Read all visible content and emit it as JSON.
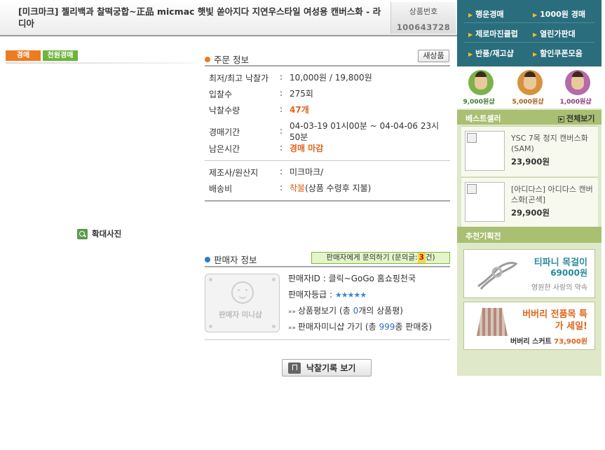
{
  "header": {
    "title": "[미크마크] 젤리백과 찰떡궁합~正品 micmac 햇빛 쏟아지다 지연우스타일 여성용 캔버스화 - 라디아",
    "item_no_label": "상품번호",
    "item_no": "100643728"
  },
  "left": {
    "badges": [
      "경매",
      "천원경매"
    ],
    "zoom_label": "확대사진"
  },
  "order": {
    "heading": "주문 정보",
    "new_button": "새상품",
    "rows": [
      {
        "label": "최저/최고 낙찰가",
        "value": "10,000원 / 19,800원"
      },
      {
        "label": "입찰수",
        "value": "275회"
      },
      {
        "label": "낙찰수량",
        "value": "47개"
      },
      {
        "label": "경매기간",
        "value": "04-03-19 01시00분 ~ 04-04-06 23시 50분"
      },
      {
        "label": "남은시간",
        "value": "경매 마감"
      }
    ],
    "rows2": [
      {
        "label": "제조사/원산지",
        "value": "미크마크/"
      },
      {
        "label": "배송비",
        "value_highlight": "착불",
        "value_rest": "(상품 수령후 지불)"
      }
    ],
    "colon": ":"
  },
  "seller": {
    "heading": "판매자 정보",
    "ask_prefix": "판매자에게 문의하기 (문의글:",
    "ask_count": "3",
    "ask_suffix": "건)",
    "mini_shop_label": "판매자 미니샵",
    "id_label": "판매자ID : ",
    "id_value": "클릭~GoGo 홈쇼핑천국",
    "grade_label": "판매자등급 : ",
    "grade_stars": "★★★★★",
    "review_prefix": "상품평보기 (총 ",
    "review_count": "0",
    "review_suffix": "개의 상품평)",
    "shop_prefix": "판매자미니샵 가기 (총 ",
    "shop_count": "999",
    "shop_suffix": "종 판매중)",
    "arrow_glyph": "»»",
    "bid_record_button": "낙찰기록 보기"
  },
  "sidebar": {
    "nav": [
      {
        "label": "행운경매"
      },
      {
        "label": "1000원 경매"
      },
      {
        "label": "제로마진클럽"
      },
      {
        "label": "열린가판대"
      },
      {
        "label": "반품/재고샵"
      },
      {
        "label": "할인쿠폰모음"
      }
    ],
    "nav_marker": "▶",
    "coins": [
      {
        "amount": "9,000원샵",
        "color": "#3f7d2e",
        "ring": "#7bb24a"
      },
      {
        "amount": "5,000원샵",
        "color": "#a5601c",
        "ring": "#d8913d"
      },
      {
        "amount": "1,000원샵",
        "color": "#8a3a7d",
        "ring": "#b56aa9"
      }
    ],
    "best_title": "베스트셀러",
    "best_more": "전체보기",
    "best_more_glyph": "▶",
    "best_items": [
      {
        "name": "YSC 7목 청지 캔버스화(SAM)",
        "price": "23,900원"
      },
      {
        "name": "[아디다스] 아디다스 캔버스화[곤색]",
        "price": "29,900원"
      }
    ],
    "rec_title": "추천기획전",
    "ads": [
      {
        "title": "티파니 목걸이",
        "price": "69000원",
        "sub": "영원한 사랑의 약속",
        "title_color": "#2a8a9a"
      },
      {
        "title": "버버리 전품목 특가 세일!",
        "sub_name": "버버리 스커트 ",
        "sub_price": "73,900원",
        "title_color": "#e0641a"
      }
    ]
  }
}
